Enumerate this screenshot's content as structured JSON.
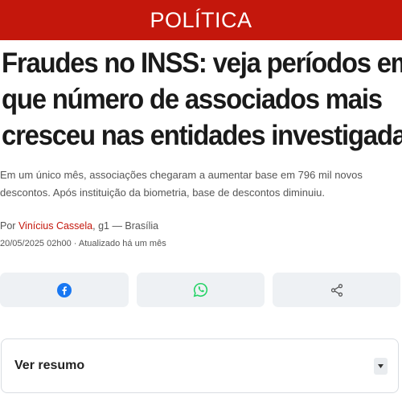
{
  "section": {
    "label": "POLÍTICA"
  },
  "article": {
    "headline_lines": [
      "Fraudes no INSS: veja períodos em",
      "que número de associados mais",
      "cresceu nas entidades investigadas"
    ],
    "subtitle": "Em um único mês, associações chegaram a aumentar base em 796 mil novos descontos. Após instituição da biometria, base de descontos diminuiu.",
    "byline": {
      "prefix": "Por ",
      "author": "Vinícius Cassela",
      "suffix": ", g1 — Brasília"
    },
    "dateline": "20/05/2025 02h00 · Atualizado há um mês"
  },
  "share": {
    "buttons": [
      {
        "icon": "facebook-icon",
        "color": "#1877f2"
      },
      {
        "icon": "whatsapp-icon",
        "color": "#25d366"
      },
      {
        "icon": "share-icon",
        "color": "#555555"
      }
    ]
  },
  "summary": {
    "label": "Ver resumo",
    "toggle_icon": "chevron-down-icon"
  },
  "colors": {
    "brand": "#c4170c",
    "share_bg": "#eef1f4"
  }
}
